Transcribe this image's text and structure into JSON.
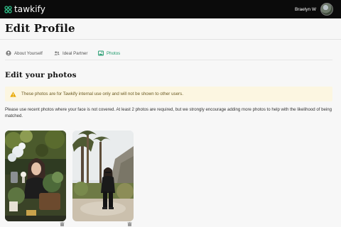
{
  "header": {
    "brand": "tawkify",
    "user_name": "Braelyn W"
  },
  "page": {
    "title": "Edit Profile"
  },
  "tabs": [
    {
      "label": "About Yourself",
      "icon": "user-circle-icon",
      "active": false
    },
    {
      "label": "Ideal Partner",
      "icon": "users-icon",
      "active": false
    },
    {
      "label": "Photos",
      "icon": "image-icon",
      "active": true
    }
  ],
  "section": {
    "title": "Edit your photos"
  },
  "notice": {
    "text": "These photos are for Tawkify internal use only and will not be shown to other users.",
    "icon": "warning-icon"
  },
  "instructions": "Please use recent photos where your face is not covered. At least 2 photos are required, but we strongly encourage adding more photos to help with the likelihood of being matched.",
  "photos": [
    {
      "alt": "photo-1",
      "action_icon": "delete-icon"
    },
    {
      "alt": "photo-2",
      "action_icon": "delete-icon"
    }
  ],
  "colors": {
    "topbar": "#0b0b0b",
    "accent": "#1f9a6c",
    "notice_bg": "#fcf6e1",
    "warning": "#e8a800"
  }
}
